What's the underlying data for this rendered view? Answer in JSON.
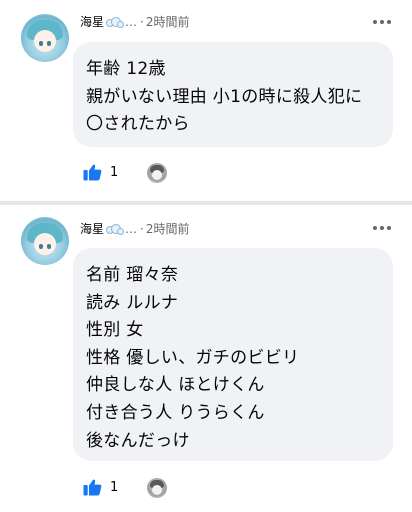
{
  "comments": [
    {
      "author": "海星",
      "author_suffix": "…",
      "separator": "·",
      "time": "2時間前",
      "lines": [
        "年齢 12歳",
        "親がいない理由 小1の時に殺人犯に",
        "〇されたから"
      ],
      "like_count": "1"
    },
    {
      "author": "海星",
      "author_suffix": "…",
      "separator": "·",
      "time": "2時間前",
      "lines": [
        "名前 瑠々奈",
        "読み ルルナ",
        "性別 女",
        "性格 優しい、ガチのビビリ",
        "仲良しな人 ほとけくん",
        "付き合う人 りうらくん",
        "後なんだっけ"
      ],
      "like_count": "1"
    }
  ],
  "colors": {
    "bubble_bg": "#f0f2f5",
    "like_blue": "#1877f2",
    "meta_gray": "#65676b",
    "divider": "#e4e6eb"
  },
  "icons": {
    "like": "thumbs-up-icon",
    "more": "more-horizontal-icon",
    "badge": "bubbles-icon"
  }
}
